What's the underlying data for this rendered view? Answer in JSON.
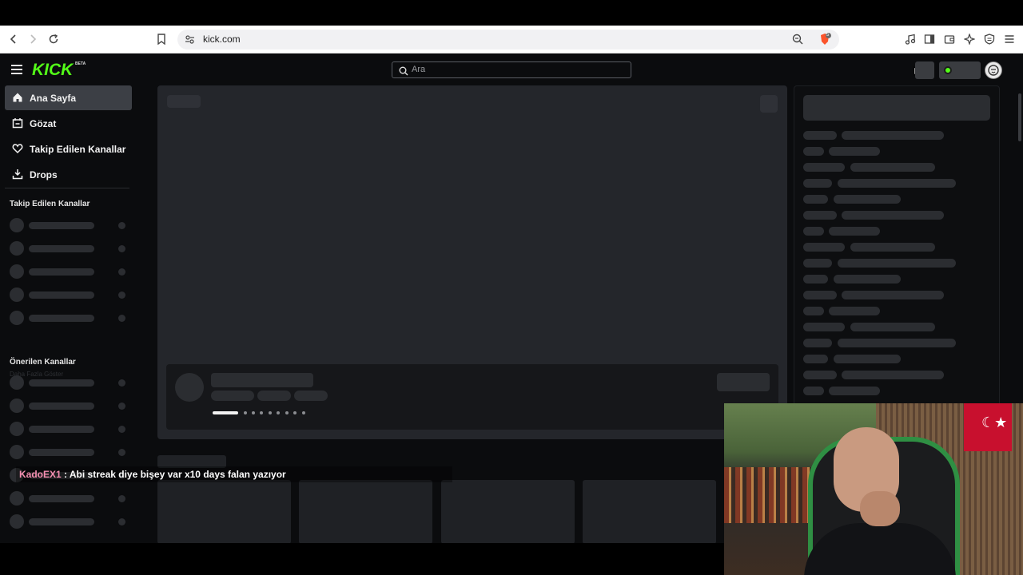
{
  "browser": {
    "url": "kick.com",
    "brave_badge_count": "5"
  },
  "header": {
    "logo_text": "KICK",
    "logo_badge": "BETA",
    "search_placeholder": "Ara"
  },
  "sidebar": {
    "nav": [
      {
        "label": "Ana Sayfa",
        "icon": "home-icon",
        "active": true
      },
      {
        "label": "Gözat",
        "icon": "browse-icon",
        "active": false
      },
      {
        "label": "Takip Edilen Kanallar",
        "icon": "heart-icon",
        "active": false
      },
      {
        "label": "Drops",
        "icon": "drops-icon",
        "active": false
      }
    ],
    "followed_heading": "Takip Edilen Kanallar",
    "faded_text": "Daha Fazla Göster",
    "recommended_heading": "Önerilen Kanallar"
  },
  "chat_overlay": {
    "username": "KadoEX1",
    "message": ": Abi streak diye bişey var x10 days falan yazıyor"
  },
  "colors": {
    "brand": "#53fc18",
    "chat_user": "#f48fb1",
    "bg": "#0b0c0e",
    "panel": "#24262b"
  }
}
